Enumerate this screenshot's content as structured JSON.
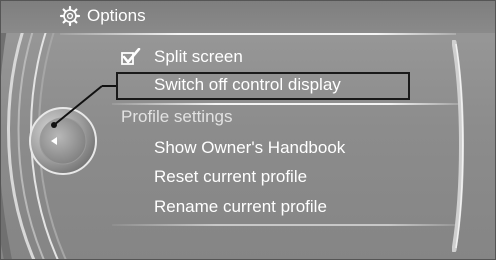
{
  "header": {
    "title": "Options",
    "icon": "gear-icon"
  },
  "menu": {
    "split_screen": {
      "label": "Split screen",
      "checked": true,
      "icon": "checkbox-checked-icon"
    },
    "switch_off": {
      "label": "Switch off control display"
    },
    "profile_heading": "Profile settings",
    "show_handbook": {
      "label": "Show Owner's Handbook"
    },
    "reset_profile": {
      "label": "Reset current profile"
    },
    "rename_profile": {
      "label": "Rename current profile"
    }
  },
  "controller": {
    "icon": "controller-left-arrow-icon"
  },
  "colors": {
    "background": "#8c8c8c",
    "text": "#ffffff",
    "outline": "#1a1a1a"
  }
}
